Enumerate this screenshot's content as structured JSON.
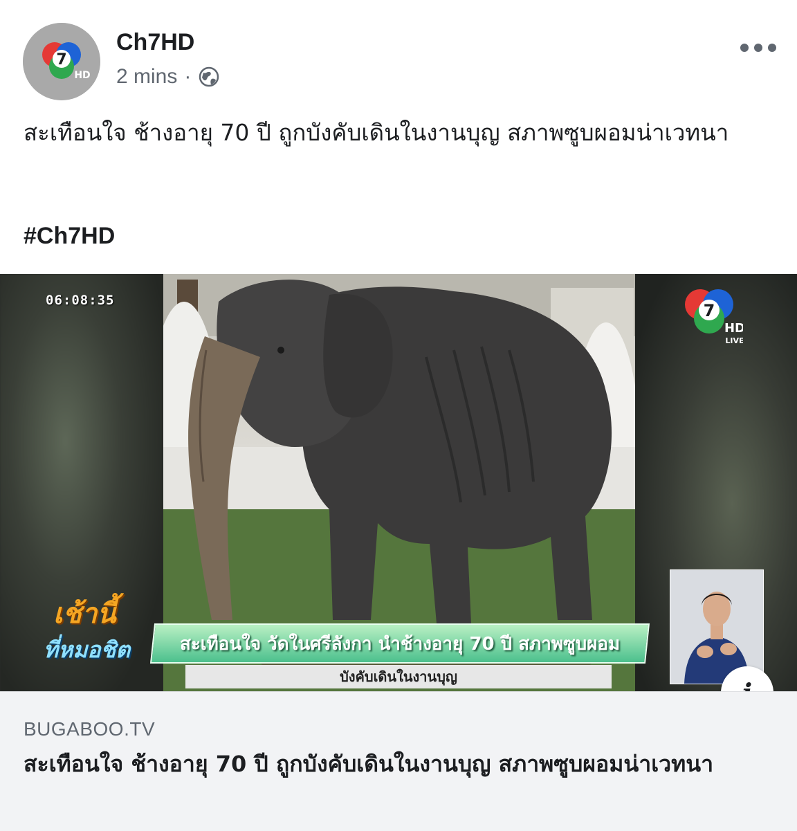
{
  "post": {
    "author": "Ch7HD",
    "time": "2 mins",
    "separator": "·",
    "privacy_icon": "globe-icon",
    "more_icon": "more-options-icon",
    "caption": "สะเทือนใจ ช้างอายุ 70 ปี ถูกบังคับเดินในงานบุญ สภาพซูบผอมน่าเวทนา",
    "hashtag": "#Ch7HD"
  },
  "media": {
    "timestamp": "06:08:35",
    "channel_logo_text": "7",
    "channel_hd": "HD",
    "channel_live": "LIVE",
    "show_logo_line1": "เช้านี้",
    "show_logo_line2": "ที่หมอชิต",
    "ticker_main": "สะเทือนใจ วัดในศรีลังกา นำช้างอายุ 70 ปี สภาพซูบผอม",
    "ticker_sub": "บังคับเดินในงานบุญ",
    "info_label": "i"
  },
  "link_preview": {
    "domain": "BUGABOO.TV",
    "title": "สะเทือนใจ ช้างอายุ 70 ปี ถูกบังคับเดินในงานบุญ สภาพซูบผอมน่าเวทนา"
  },
  "colors": {
    "text_primary": "#1c1e21",
    "text_secondary": "#606770",
    "preview_bg": "#f2f3f5",
    "ticker_green": "#4cc08d"
  }
}
